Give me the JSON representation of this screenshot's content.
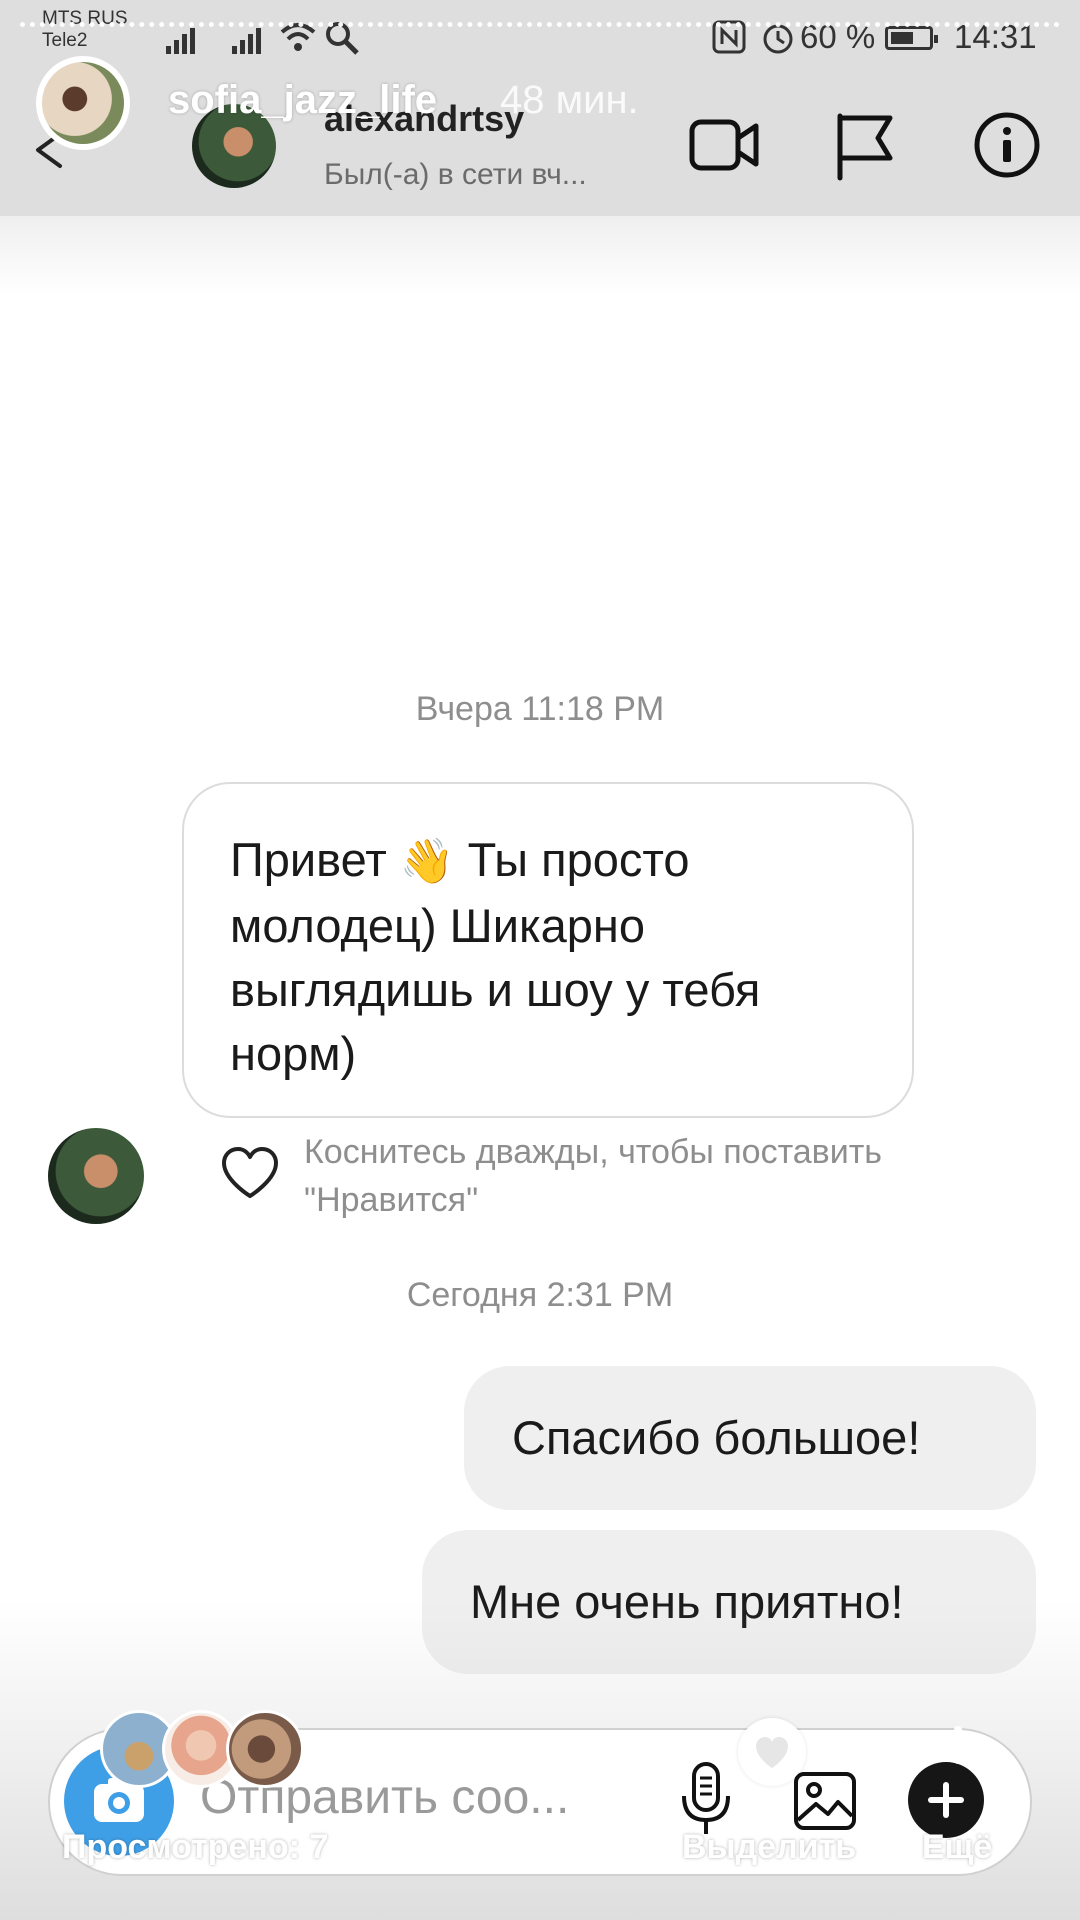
{
  "status_bar": {
    "carrier_1": "MTS RUS",
    "carrier_2": "Tele2",
    "battery_percent": "60 %",
    "time": "14:31"
  },
  "story": {
    "username": "sofia_jazz_life",
    "time_ago": "48 мин."
  },
  "header": {
    "contact_name": "alexandrtsy",
    "contact_status": "Был(-а) в сети вч..."
  },
  "messages": {
    "timestamp_1": "Вчера 11:18 PM",
    "incoming": {
      "text_1": "Привет ",
      "emoji": "👋",
      "text_2": " Ты просто молодец)  Шикарно выглядишь и шоу у тебя норм)"
    },
    "like_hint": "Коснитесь дважды, чтобы поставить \"Нравится\"",
    "timestamp_2": "Сегодня 2:31 PM",
    "outgoing_1": "Спасибо большое!",
    "outgoing_2": "Мне очень приятно!"
  },
  "composer": {
    "placeholder": "Отправить соо..."
  },
  "story_footer": {
    "seen": "Просмотрено: 7",
    "highlight": "Выделить",
    "more": "Ещё"
  },
  "colors": {
    "header_bg": "#dedede",
    "camera_button": "#3f9fe6",
    "outgoing_bubble": "#efefef"
  }
}
